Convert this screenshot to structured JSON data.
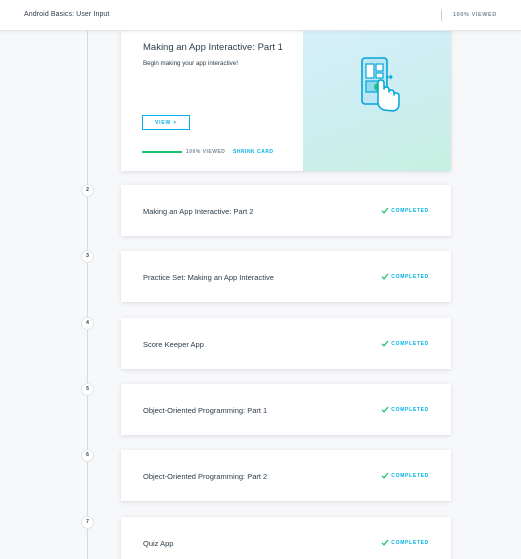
{
  "header": {
    "course_title": "Android Basics: User Input",
    "progress_text": "100% VIEWED"
  },
  "current_lesson": {
    "title": "Making an App Interactive: Part 1",
    "subtitle": "Begin making your app interactive!",
    "view_label": "VIEW >",
    "viewed_text": "100% VIEWED",
    "shrink_label": "SHRINK CARD",
    "progress_fraction": 1.0,
    "illustration_icon": "phone-touch-icon"
  },
  "lessons": [
    {
      "number": "2",
      "title": "Making an App Interactive: Part 2",
      "status": "COMPLETED"
    },
    {
      "number": "3",
      "title": "Practice Set: Making an App Interactive",
      "status": "COMPLETED"
    },
    {
      "number": "4",
      "title": "Score Keeper App",
      "status": "COMPLETED"
    },
    {
      "number": "5",
      "title": "Object-Oriented Programming: Part 1",
      "status": "COMPLETED"
    },
    {
      "number": "6",
      "title": "Object-Oriented Programming: Part 2",
      "status": "COMPLETED"
    },
    {
      "number": "7",
      "title": "Quiz App",
      "status": "COMPLETED"
    }
  ],
  "colors": {
    "accent": "#02b3e4",
    "success": "#15c26b",
    "text": "#2e3d49"
  }
}
